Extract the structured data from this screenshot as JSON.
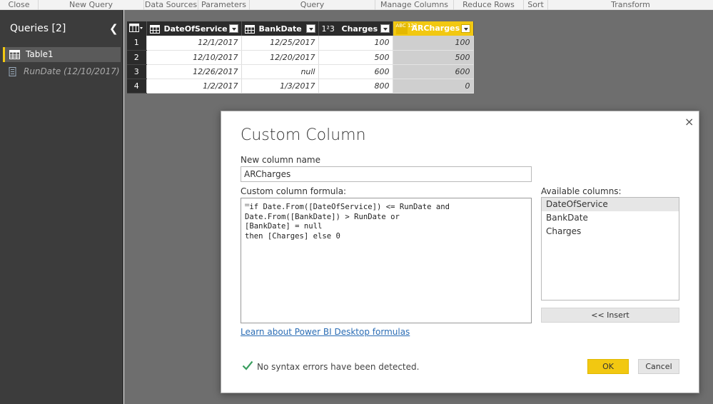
{
  "ribbon": {
    "groups": [
      "Close",
      "New Query",
      "Data Sources",
      "Parameters",
      "Query",
      "Manage Columns",
      "Reduce Rows",
      "Sort",
      "Transform"
    ]
  },
  "queries": {
    "title": "Queries [2]",
    "items": [
      {
        "label": "Table1",
        "selected": true
      },
      {
        "label": "RunDate (12/10/2017)",
        "selected": false
      }
    ]
  },
  "grid": {
    "columns": [
      {
        "name": "DateOfService",
        "type": "date"
      },
      {
        "name": "BankDate",
        "type": "date"
      },
      {
        "name": "Charges",
        "type": "1²3"
      },
      {
        "name": "ARCharges",
        "type": "ABC 123"
      }
    ],
    "rows": [
      {
        "index": "1",
        "cells": [
          "12/1/2017",
          "12/25/2017",
          "100",
          "100"
        ]
      },
      {
        "index": "2",
        "cells": [
          "12/10/2017",
          "12/20/2017",
          "500",
          "500"
        ]
      },
      {
        "index": "3",
        "cells": [
          "12/26/2017",
          "null",
          "600",
          "600"
        ]
      },
      {
        "index": "4",
        "cells": [
          "1/2/2017",
          "1/3/2017",
          "800",
          "0"
        ]
      }
    ]
  },
  "dialog": {
    "title": "Custom Column",
    "close_icon": "×",
    "new_column_label": "New column name",
    "new_column_value": "ARCharges",
    "formula_label": "Custom column formula:",
    "formula_eq": "=",
    "formula": " if Date.From([DateOfService]) <= RunDate and\nDate.From([BankDate]) > RunDate or\n[BankDate] = null\nthen [Charges] else 0",
    "available_label": "Available columns:",
    "available_columns": [
      "DateOfService",
      "BankDate",
      "Charges"
    ],
    "insert_label": "<< Insert",
    "learn_link": "Learn about Power BI Desktop formulas",
    "syntax_status": "No syntax errors have been detected.",
    "ok_label": "OK",
    "cancel_label": "Cancel"
  },
  "colors": {
    "accent": "#f2c811",
    "pane_bg": "#3c3c3c",
    "check": "#3a9e5f",
    "link": "#2b6db5"
  }
}
